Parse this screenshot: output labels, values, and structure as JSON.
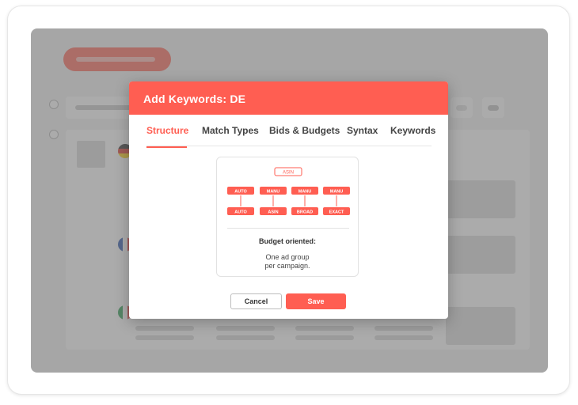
{
  "modal": {
    "title": "Add Keywords: DE",
    "tabs": [
      {
        "label": "Structure",
        "active": true
      },
      {
        "label": "Match Types",
        "active": false
      },
      {
        "label": "Bids & Budgets",
        "active": false
      },
      {
        "label": "Syntax",
        "active": false
      },
      {
        "label": "Keywords",
        "active": false
      }
    ],
    "diagram": {
      "root": "ASIN",
      "columns": [
        {
          "top": "AUTO",
          "bottom": "AUTO"
        },
        {
          "top": "MANU",
          "bottom": "ASIN"
        },
        {
          "top": "MANU",
          "bottom": "BROAD"
        },
        {
          "top": "MANU",
          "bottom": "EXACT"
        }
      ]
    },
    "budget_title": "Budget oriented:",
    "budget_desc_line1": "One ad group",
    "budget_desc_line2": "per campaign.",
    "cancel_label": "Cancel",
    "save_label": "Save"
  },
  "colors": {
    "accent": "#ff5e52",
    "overlay": "#787878"
  }
}
